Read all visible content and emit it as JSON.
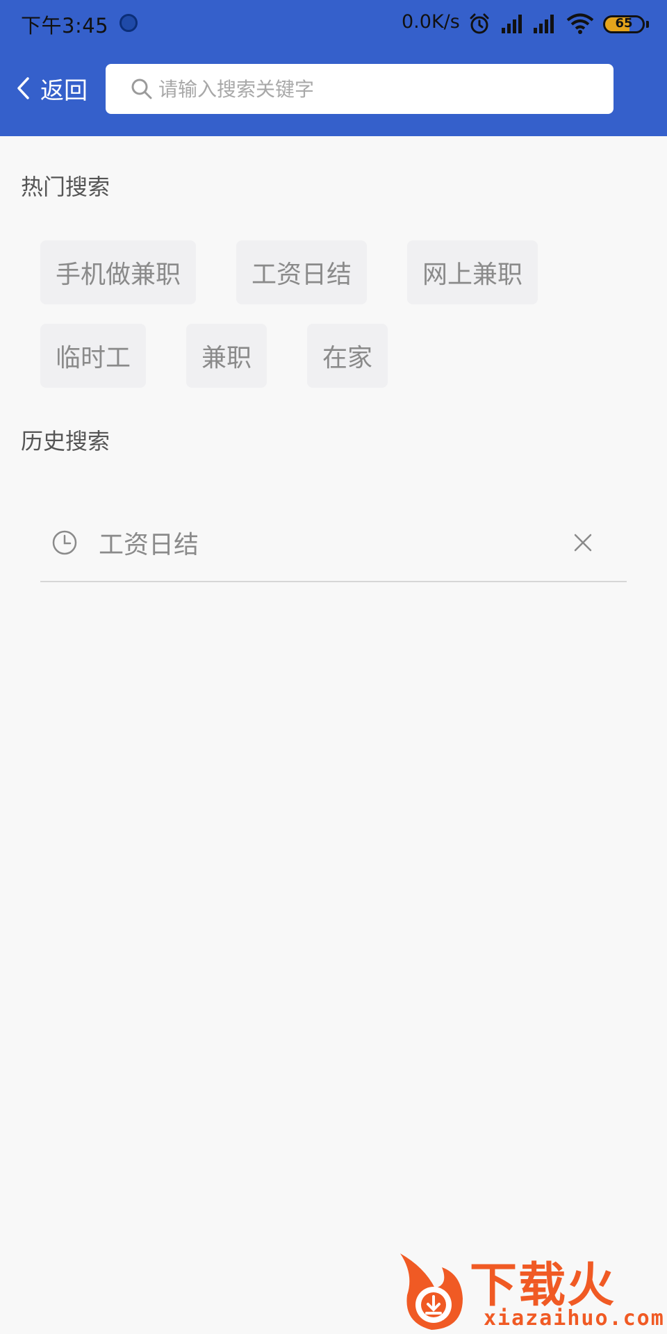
{
  "status_bar": {
    "time": "下午3:45",
    "network_speed": "0.0K/s",
    "battery": "65",
    "battery_level": 0.65
  },
  "nav": {
    "back_label": "返回",
    "search_placeholder": "请输入搜索关键字"
  },
  "hot_search": {
    "title": "热门搜索",
    "rows": [
      [
        "手机做兼职",
        "工资日结",
        "网上兼职"
      ],
      [
        "临时工",
        "兼职",
        "在家"
      ]
    ]
  },
  "history": {
    "title": "历史搜索",
    "items": [
      "工资日结"
    ]
  },
  "watermark": {
    "brand": "下载火",
    "domain": "xiazaihuo.com"
  },
  "colors": {
    "header_bg": "#3560cb",
    "page_bg": "#f8f8f8",
    "tag_bg": "#f0f0f2",
    "watermark": "#f05a24"
  }
}
